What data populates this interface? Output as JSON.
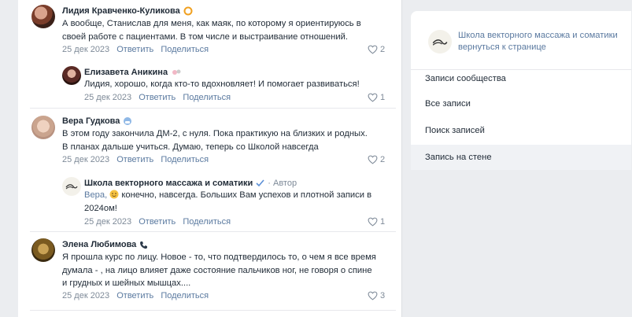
{
  "comments": [
    {
      "name": "Лидия Кравченко-Куликова",
      "badge_icon": "orange-ring-icon",
      "lines": [
        "А вообще, Станислав для меня, как маяк, по которому я ориентируюсь в",
        "своей работе с пациентами. В том числе и выстраивание отношений."
      ],
      "date": "25 дек 2023",
      "reply": "Ответить",
      "share": "Поделиться",
      "likes": "2"
    },
    {
      "name": "Елизавета Аникина",
      "badge_icon": "sticker-icon",
      "lines": [
        "Лидия, хорошо, когда кто-то вдохновляет! И помогает развиваться!"
      ],
      "date": "25 дек 2023",
      "reply": "Ответить",
      "share": "Поделиться",
      "likes": "1"
    },
    {
      "name": "Вера Гудкова",
      "badge_icon": "face-mask-icon",
      "lines": [
        "В этом году закончила ДМ-2, с нуля. Пока практикую на близких и родных.",
        "В планах дальше учиться. Думаю, теперь со Школой навсегда"
      ],
      "date": "25 дек 2023",
      "reply": "Ответить",
      "share": "Поделиться",
      "likes": "2"
    },
    {
      "name": "Школа векторного массажа и соматики",
      "badge_icon": "verified-check-icon",
      "author": "· Автор",
      "mention": "Вера,",
      "lines": [
        " конечно, навсегда. Больших Вам успехов и плотной записи в",
        "2024ом!"
      ],
      "date": "25 дек 2023",
      "reply": "Ответить",
      "share": "Поделиться",
      "likes": "1"
    },
    {
      "name": "Элена Любимова",
      "badge_icon": "phone-icon",
      "lines": [
        "Я прошла курс по лицу. Новое - то, что подтвердилось то, о чем я все время",
        "думала - , на лицо влияет даже состояние пальчиков ног, не говоря о спине",
        "и грудных и шейных мышцах...."
      ],
      "date": "25 дек 2023",
      "reply": "Ответить",
      "share": "Поделиться",
      "likes": "3"
    }
  ],
  "sidebar": {
    "title": "Школа векторного массажа и соматики",
    "back": "вернуться к странице",
    "items": [
      "Записи сообщества",
      "Все записи",
      "Поиск записей",
      "Запись на стене"
    ]
  },
  "colors": {
    "link": "#5b7aa0",
    "muted": "#7e8a98",
    "text": "#1f2a36"
  }
}
